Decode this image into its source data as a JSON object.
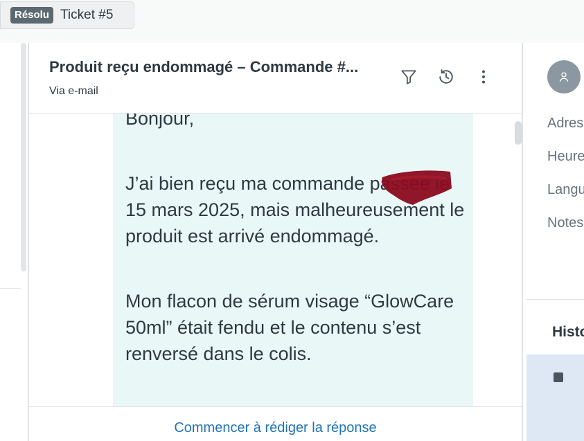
{
  "topbar": {
    "status_badge": "Résolu",
    "ticket_label": "Ticket #5"
  },
  "ticket": {
    "subject": "Produit reçu endommagé – Commande #...",
    "channel": "Via e-mail"
  },
  "header_actions": {
    "filter_icon": "filter-icon",
    "history_icon": "history-icon",
    "more_icon": "more-options-icon"
  },
  "message": {
    "greeting": "Bonjour,",
    "paragraph1": "J’ai bien reçu ma commande  passée le 15 mars 2025, mais malheureusement le produit est arrivé endommagé.",
    "paragraph2": "Mon flacon de sérum visage “GlowCare 50ml” était fendu et le contenu s’est renversé dans le colis."
  },
  "composer": {
    "start_reply": "Commencer à rédiger la réponse"
  },
  "customer_panel": {
    "fields": [
      "Adres",
      "Heure",
      "Langu",
      "Notes"
    ],
    "history_heading": "Histo"
  },
  "colors": {
    "bubble": "#e9f7f6",
    "link": "#1f73b7",
    "badge": "#5c6970",
    "redaction": "#8b0a1e"
  }
}
